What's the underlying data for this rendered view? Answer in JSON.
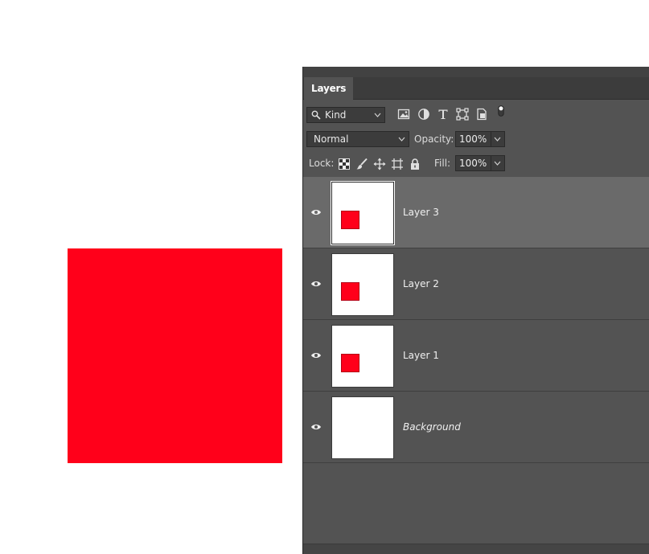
{
  "canvas": {
    "shape_color": "#ff001a"
  },
  "panel": {
    "tab_label": "Layers",
    "filter": {
      "kind_label": "Kind",
      "icons": [
        "image-filter-icon",
        "adjustment-filter-icon",
        "type-filter-icon",
        "shape-filter-icon",
        "smart-object-filter-icon",
        "filter-toggle-icon"
      ]
    },
    "blend_mode": "Normal",
    "opacity_label": "Opacity:",
    "opacity_value": "100%",
    "lock_label": "Lock:",
    "lock_icons": [
      "lock-transparent-pixels-icon",
      "lock-image-pixels-icon",
      "lock-position-icon",
      "lock-artboard-icon",
      "lock-all-icon"
    ],
    "fill_label": "Fill:",
    "fill_value": "100%",
    "layers": [
      {
        "name": "Layer 3",
        "selected": true,
        "visible": true,
        "has_shape": true
      },
      {
        "name": "Layer 2",
        "selected": false,
        "visible": true,
        "has_shape": true
      },
      {
        "name": "Layer 1",
        "selected": false,
        "visible": true,
        "has_shape": true
      },
      {
        "name": "Background",
        "selected": false,
        "visible": true,
        "has_shape": false,
        "italic": true
      }
    ]
  },
  "colors": {
    "panel_bg": "#535353",
    "selected_row": "#6a6a6a",
    "accent_red": "#ff001a"
  }
}
